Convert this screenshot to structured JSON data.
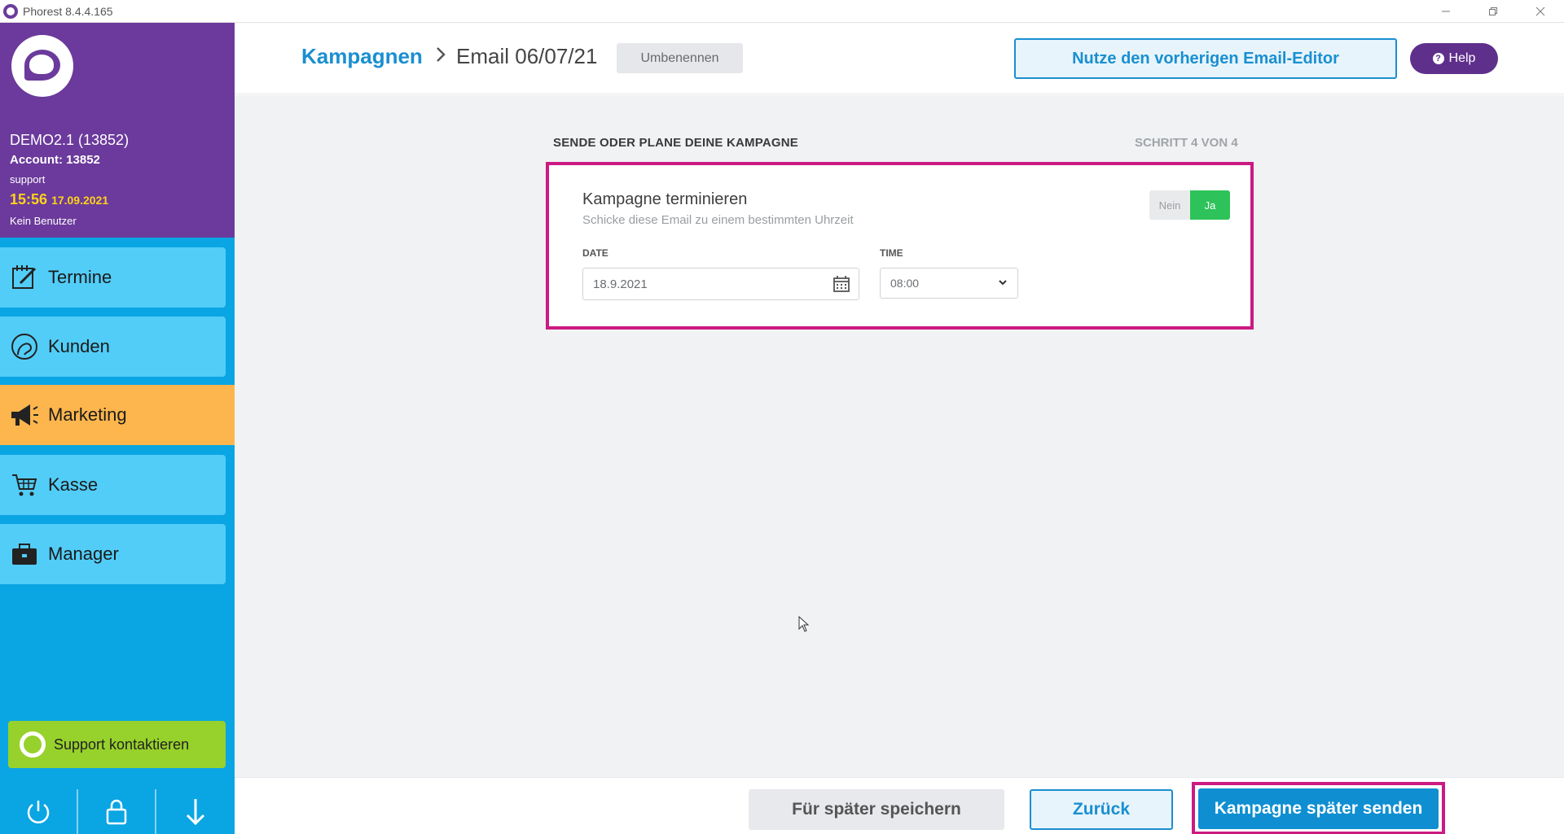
{
  "window": {
    "title": "Phorest 8.4.4.165"
  },
  "profile": {
    "company": "DEMO2.1 (13852)",
    "account": "Account: 13852",
    "role": "support",
    "time": "15:56",
    "date": "17.09.2021",
    "user": "Kein Benutzer"
  },
  "nav": {
    "items": [
      {
        "label": "Termine",
        "icon": "calendar-edit-icon"
      },
      {
        "label": "Kunden",
        "icon": "client-head-icon"
      },
      {
        "label": "Marketing",
        "icon": "megaphone-icon",
        "active": true
      },
      {
        "label": "Kasse",
        "icon": "cart-icon"
      },
      {
        "label": "Manager",
        "icon": "briefcase-icon"
      }
    ],
    "support_label": "Support kontaktieren"
  },
  "header": {
    "breadcrumb_link": "Kampagnen",
    "breadcrumb_current": "Email 06/07/21",
    "rename_label": "Umbenennen",
    "legacy_editor_label": "Nutze den vorherigen Email-Editor",
    "help_label": "Help"
  },
  "main": {
    "section_title": "SENDE ODER PLANE DEINE KAMPAGNE",
    "step_label": "SCHRITT 4 VON 4",
    "card": {
      "title": "Kampagne terminieren",
      "subtitle": "Schicke diese Email zu einem bestimmten Uhrzeit",
      "toggle_off": "Nein",
      "toggle_on": "Ja",
      "date_label": "DATE",
      "date_value": "18.9.2021",
      "time_label": "TIME",
      "time_value": "08:00"
    }
  },
  "footer": {
    "save_later_label": "Für später speichern",
    "back_label": "Zurück",
    "send_later_label": "Kampagne später senden"
  },
  "colors": {
    "sidebar_blue": "#0aa5e3",
    "nav_item_blue": "#52cdf8",
    "active_orange": "#fdb64d",
    "profile_purple": "#6b3a9c",
    "highlight_magenta": "#cc1a82",
    "primary_blue": "#0f8fd1",
    "toggle_green": "#2ec35a",
    "support_green": "#97d12b"
  }
}
